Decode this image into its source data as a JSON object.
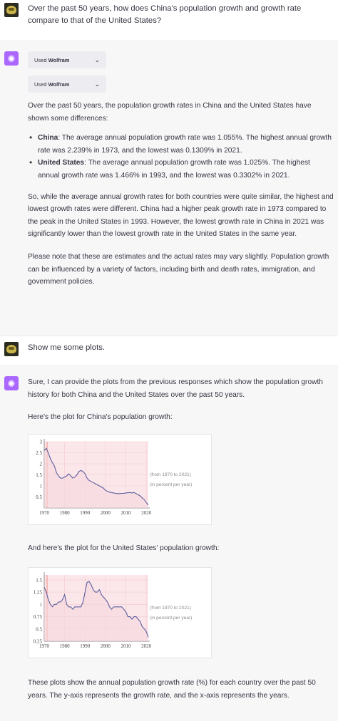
{
  "conversation": {
    "user_question_1": "Over the past 50 years, how does China's population growth and growth rate compare to that of the United States?",
    "plugin": {
      "prefix": "Used",
      "name": "Wolfram",
      "chevron_icon": "chevron-down-icon"
    },
    "answer_intro": "Over the past 50 years, the population growth rates in China and the United States have shown some differences:",
    "bullets": [
      {
        "label": "China",
        "text": ": The average annual population growth rate was 1.055%. The highest annual growth rate was 2.239% in 1973, and the lowest was 0.1309% in 2021."
      },
      {
        "label": "United States",
        "text": ": The average annual population growth rate was 1.025%. The highest annual growth rate was 1.466% in 1993, and the lowest was 0.3302% in 2021."
      }
    ],
    "answer_para_2": "So, while the average annual growth rates for both countries were quite similar, the highest and lowest growth rates were different. China had a higher peak growth rate in 1973 compared to the peak in the United States in 1993. However, the lowest growth rate in China in 2021 was significantly lower than the lowest growth rate in the United States in the same year.",
    "answer_para_3": "Please note that these are estimates and the actual rates may vary slightly. Population growth can be influenced by a variety of factors, including birth and death rates, immigration, and government policies.",
    "user_question_2": "Show me some plots.",
    "plots_intro": "Sure, I can provide the plots from the previous responses which show the population growth history for both China and the United States over the past 50 years.",
    "china_plot_intro": "Here's the plot for China's population growth:",
    "us_plot_intro": "And here's the plot for the United States' population growth:",
    "closing": "These plots show the annual population growth rate (%) for each country over the past 50 years. The y-axis represents the growth rate, and the x-axis represents the years."
  },
  "colors": {
    "bot_avatar": "#ab68ff",
    "line": "#5a5f9e",
    "fill": "#fbe7ea",
    "marker": "#f08a7e"
  },
  "chart_data": [
    {
      "type": "area",
      "note_line1": "(from 1970 to 2021)",
      "note_line2": "(in percent per year)",
      "xlim": [
        1970,
        2021
      ],
      "ylim": [
        0,
        3
      ],
      "xticks": [
        "1970",
        "1980",
        "1990",
        "2000",
        "2010",
        "2020"
      ],
      "yticks": [
        "0.5",
        "1",
        "1.5",
        "2",
        "2.5",
        "3"
      ],
      "x": [
        1970,
        1971,
        1972,
        1973,
        1974,
        1975,
        1976,
        1977,
        1978,
        1979,
        1980,
        1981,
        1982,
        1983,
        1984,
        1985,
        1986,
        1987,
        1988,
        1989,
        1990,
        1991,
        1992,
        1993,
        1994,
        1995,
        1996,
        1997,
        1998,
        1999,
        2000,
        2001,
        2002,
        2003,
        2004,
        2005,
        2006,
        2007,
        2008,
        2009,
        2010,
        2011,
        2012,
        2013,
        2014,
        2015,
        2016,
        2017,
        2018,
        2019,
        2020,
        2021
      ],
      "y": [
        2.6,
        2.7,
        2.5,
        2.239,
        2.05,
        1.9,
        1.6,
        1.45,
        1.35,
        1.35,
        1.4,
        1.45,
        1.55,
        1.45,
        1.35,
        1.4,
        1.5,
        1.65,
        1.7,
        1.65,
        1.55,
        1.35,
        1.25,
        1.2,
        1.15,
        1.1,
        1.05,
        1.0,
        0.95,
        0.9,
        0.8,
        0.75,
        0.72,
        0.7,
        0.68,
        0.66,
        0.65,
        0.65,
        0.66,
        0.66,
        0.68,
        0.69,
        0.7,
        0.68,
        0.7,
        0.65,
        0.6,
        0.55,
        0.45,
        0.38,
        0.25,
        0.1309
      ]
    },
    {
      "type": "area",
      "note_line1": "(from 1970 to 2021)",
      "note_line2": "(in percent per year)",
      "xlim": [
        1970,
        2021
      ],
      "ylim": [
        0.25,
        1.6
      ],
      "xticks": [
        "1970",
        "1980",
        "1990",
        "2000",
        "2010",
        "2020"
      ],
      "yticks": [
        "0.25",
        "0.5",
        "0.75",
        "1",
        "1.25",
        "1.5"
      ],
      "x": [
        1970,
        1971,
        1972,
        1973,
        1974,
        1975,
        1976,
        1977,
        1978,
        1979,
        1980,
        1981,
        1982,
        1983,
        1984,
        1985,
        1986,
        1987,
        1988,
        1989,
        1990,
        1991,
        1992,
        1993,
        1994,
        1995,
        1996,
        1997,
        1998,
        1999,
        2000,
        2001,
        2002,
        2003,
        2004,
        2005,
        2006,
        2007,
        2008,
        2009,
        2010,
        2011,
        2012,
        2013,
        2014,
        2015,
        2016,
        2017,
        2018,
        2019,
        2020,
        2021
      ],
      "y": [
        1.35,
        1.25,
        1.1,
        1.0,
        0.95,
        1.0,
        1.0,
        1.05,
        1.05,
        1.1,
        1.2,
        1.0,
        0.95,
        0.95,
        0.9,
        0.95,
        0.95,
        0.95,
        0.95,
        1.05,
        1.25,
        1.45,
        1.466,
        1.4,
        1.3,
        1.25,
        1.25,
        1.3,
        1.2,
        1.15,
        1.1,
        1.05,
        0.95,
        0.9,
        0.95,
        0.95,
        0.95,
        0.95,
        0.95,
        0.9,
        0.85,
        0.75,
        0.75,
        0.7,
        0.75,
        0.75,
        0.7,
        0.65,
        0.55,
        0.5,
        0.45,
        0.3302
      ]
    }
  ]
}
